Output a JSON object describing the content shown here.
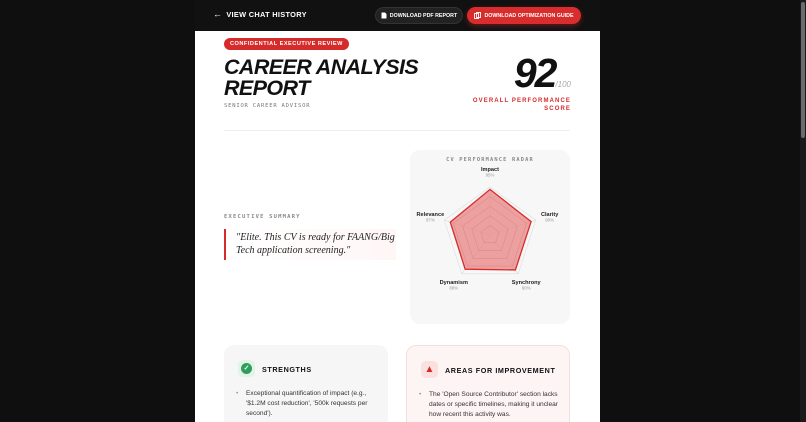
{
  "topbar": {
    "back_label": "VIEW CHAT HISTORY",
    "pdf_button": "DOWNLOAD PDF REPORT",
    "guide_button": "DOWNLOAD OPTIMIZATION GUIDE"
  },
  "header": {
    "badge": "CONFIDENTIAL EXECUTIVE REVIEW",
    "title": "CAREER ANALYSIS REPORT",
    "subtitle": "SENIOR CAREER ADVISOR",
    "score": "92",
    "score_max": "/100",
    "score_label": "OVERALL PERFORMANCE SCORE"
  },
  "summary": {
    "label": "EXECUTIVE SUMMARY",
    "quote": "\"Elite. This CV is ready for FAANG/Big Tech application screening.\""
  },
  "radar": {
    "title": "CV PERFORMANCE RADAR",
    "axes": [
      {
        "name": "Impact",
        "value": 95,
        "value_label": "95%"
      },
      {
        "name": "Clarity",
        "value": 90,
        "value_label": "90%"
      },
      {
        "name": "Synchrony",
        "value": 90,
        "value_label": "90%"
      },
      {
        "name": "Dynamism",
        "value": 88,
        "value_label": "88%"
      },
      {
        "name": "Relevance",
        "value": 87,
        "value_label": "87%"
      }
    ],
    "fill_color": "#e88a8a",
    "stroke_color": "#d62b2b"
  },
  "strengths": {
    "title": "STRENGTHS",
    "items": [
      "Exceptional quantification of impact (e.g., '$1.2M cost reduction', '500k requests per second')."
    ]
  },
  "improvements": {
    "title": "AREAS FOR IMPROVEMENT",
    "items": [
      "The 'Open Source Contributor' section lacks dates or specific timelines, making it unclear how recent this activity was."
    ]
  }
}
